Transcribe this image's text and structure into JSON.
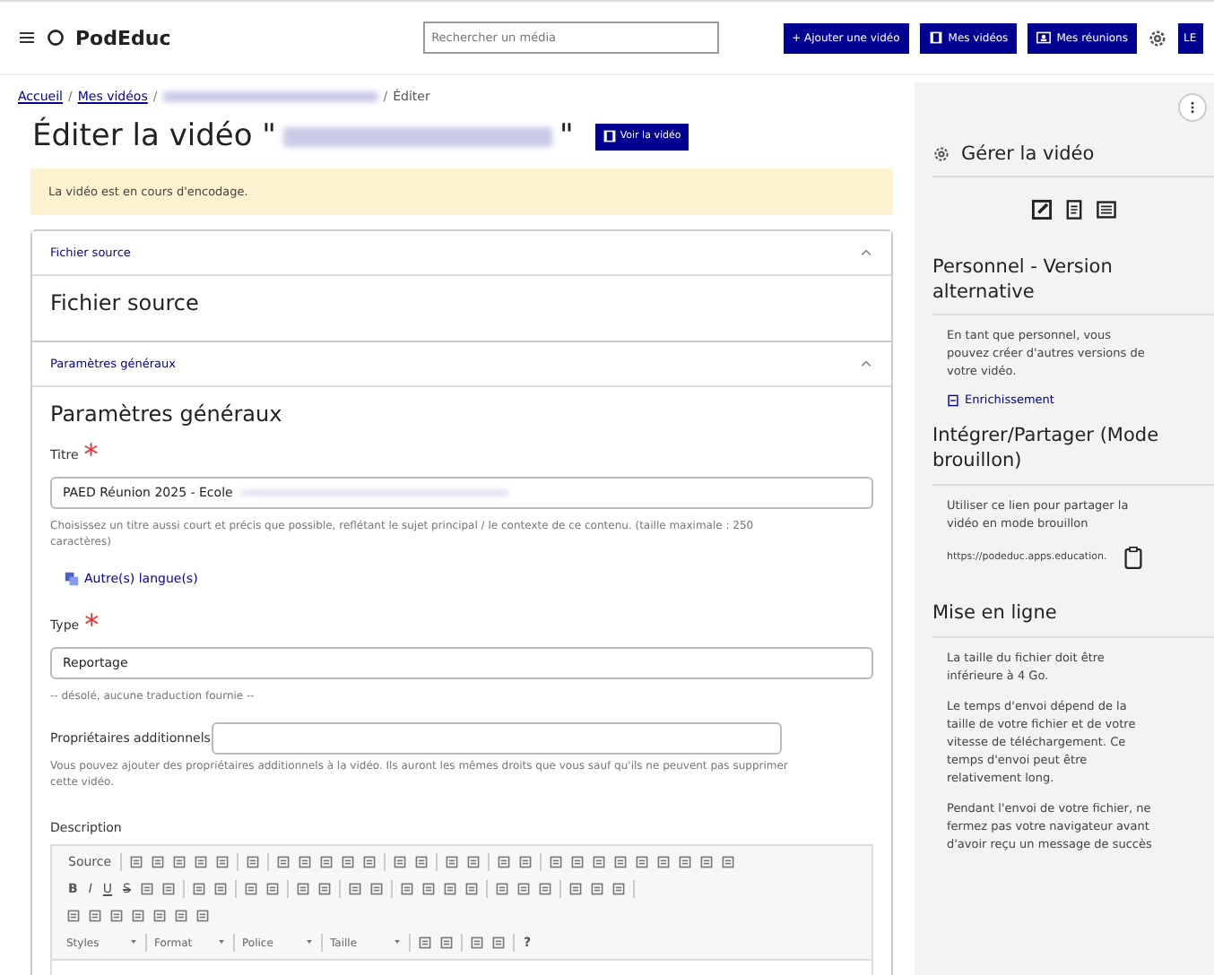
{
  "header": {
    "logo": "PodEduc",
    "search": {
      "placeholder": "Rechercher un média"
    },
    "buttons": [
      {
        "label": "+ Ajouter une vidéo",
        "kind": "text"
      },
      {
        "label": "Mes vidéos",
        "kind": "film"
      },
      {
        "label": "Mes réunions",
        "kind": "meeting"
      }
    ],
    "user": "LE"
  },
  "breadcrumb": [
    {
      "kind": "link",
      "label": "Accueil"
    },
    {
      "kind": "link",
      "label": "Mes vidéos",
      "separator": "/"
    },
    {
      "kind": "blurred",
      "separator": "/"
    },
    {
      "kind": "current",
      "label": "Éditer",
      "separator": "/"
    }
  ],
  "page_title": {
    "before": "Éditer la vidéo \"",
    "after": "\"",
    "button": "Voir la vidéo"
  },
  "alert": "La vidéo est en cours d'encodage.",
  "accordions": [
    {
      "header": "Fichier source",
      "expanded": true,
      "heading": "Fichier source"
    },
    {
      "header": "Paramètres généraux",
      "expanded": true,
      "heading": "Paramètres généraux"
    }
  ],
  "form": {
    "title_field": {
      "label": "Titre",
      "required_mark": "*",
      "value": "PAED Réunion 2025 - Ecole",
      "help": "Choisissez un titre aussi court et précis que possible, reflétant le sujet principal / le contexte de ce contenu. (taille maximale : 250 caractères)"
    },
    "languages_link": "Autre(s) langue(s)",
    "type_field": {
      "label": "Type",
      "required_mark": "*",
      "value": "Reportage",
      "note": "-- désolé, aucune traduction fournie --"
    },
    "owners_field": {
      "label": "Propriétaires additionnels",
      "help": "Vous pouvez ajouter des propriétaires additionnels à la vidéo. Ils auront les mêmes droits que vous sauf qu'ils ne peuvent pas supprimer cette vidéo."
    },
    "description": {
      "label": "Description",
      "toolbar": [
        [
          {
            "kind": "text",
            "label": "Source"
          },
          {
            "kind": "sep"
          },
          {
            "kind": "icon"
          },
          {
            "kind": "icon"
          },
          {
            "kind": "icon"
          },
          {
            "kind": "icon"
          },
          {
            "kind": "icon"
          },
          {
            "kind": "sep"
          },
          {
            "kind": "icon"
          },
          {
            "kind": "sep"
          },
          {
            "kind": "icon"
          },
          {
            "kind": "icon"
          },
          {
            "kind": "icon"
          },
          {
            "kind": "icon"
          },
          {
            "kind": "icon"
          },
          {
            "kind": "sep"
          },
          {
            "kind": "icon"
          },
          {
            "kind": "icon"
          },
          {
            "kind": "sep"
          },
          {
            "kind": "icon"
          },
          {
            "kind": "icon"
          },
          {
            "kind": "sep"
          },
          {
            "kind": "icon"
          },
          {
            "kind": "icon"
          },
          {
            "kind": "sep"
          },
          {
            "kind": "icon"
          },
          {
            "kind": "icon"
          },
          {
            "kind": "icon"
          },
          {
            "kind": "icon"
          },
          {
            "kind": "icon"
          },
          {
            "kind": "icon"
          },
          {
            "kind": "icon"
          },
          {
            "kind": "icon"
          },
          {
            "kind": "icon"
          }
        ],
        [
          {
            "kind": "bold",
            "label": "B"
          },
          {
            "kind": "italic",
            "label": "I"
          },
          {
            "kind": "underline",
            "label": "U"
          },
          {
            "kind": "strike",
            "label": "S"
          },
          {
            "kind": "icon"
          },
          {
            "kind": "icon"
          },
          {
            "kind": "sep"
          },
          {
            "kind": "icon"
          },
          {
            "kind": "icon"
          },
          {
            "kind": "sep"
          },
          {
            "kind": "icon"
          },
          {
            "kind": "icon"
          },
          {
            "kind": "sep"
          },
          {
            "kind": "icon"
          },
          {
            "kind": "icon"
          },
          {
            "kind": "sep"
          },
          {
            "kind": "icon"
          },
          {
            "kind": "icon"
          },
          {
            "kind": "sep"
          },
          {
            "kind": "icon"
          },
          {
            "kind": "icon"
          },
          {
            "kind": "icon"
          },
          {
            "kind": "icon"
          },
          {
            "kind": "sep"
          },
          {
            "kind": "icon"
          },
          {
            "kind": "icon"
          },
          {
            "kind": "icon"
          },
          {
            "kind": "sep"
          },
          {
            "kind": "icon"
          },
          {
            "kind": "icon"
          },
          {
            "kind": "icon"
          },
          {
            "kind": "sep"
          }
        ],
        [
          {
            "kind": "icon"
          },
          {
            "kind": "icon"
          },
          {
            "kind": "icon"
          },
          {
            "kind": "icon"
          },
          {
            "kind": "icon"
          },
          {
            "kind": "icon"
          },
          {
            "kind": "icon"
          }
        ],
        [
          {
            "kind": "dropdown",
            "label": "Styles"
          },
          {
            "kind": "sep"
          },
          {
            "kind": "dropdown",
            "label": "Format"
          },
          {
            "kind": "sep"
          },
          {
            "kind": "dropdown",
            "label": "Police"
          },
          {
            "kind": "sep"
          },
          {
            "kind": "dropdown",
            "label": "Taille"
          },
          {
            "kind": "sep"
          },
          {
            "kind": "icon"
          },
          {
            "kind": "icon"
          },
          {
            "kind": "sep"
          },
          {
            "kind": "icon"
          },
          {
            "kind": "icon"
          },
          {
            "kind": "sep"
          },
          {
            "kind": "bold",
            "label": "?"
          }
        ]
      ]
    }
  },
  "sidebar": {
    "title": "Gérer la vidéo",
    "sections": [
      {
        "heading": "Personnel - Version alternative",
        "items": [
          {
            "kind": "paragraph",
            "text": "En tant que personnel, vous pouvez créer d'autres versions de votre vidéo."
          },
          {
            "kind": "link",
            "text": "Enrichissement"
          }
        ]
      },
      {
        "heading": "Intégrer/Partager (Mode brouillon)",
        "items": [
          {
            "kind": "paragraph",
            "text": "Utiliser ce lien pour partager la vidéo en mode brouillon"
          },
          {
            "kind": "url",
            "text": "https://podeduc.apps.education."
          }
        ]
      },
      {
        "heading": "Mise en ligne",
        "items": [
          {
            "kind": "paragraph",
            "text": "La taille du fichier doit être inférieure à 4 Go."
          },
          {
            "kind": "paragraph",
            "text": "Le temps d'envoi dépend de la taille de votre fichier et de votre vitesse de téléchargement. Ce temps d'envoi peut être relativement long."
          },
          {
            "kind": "paragraph",
            "text": "Pendant l'envoi de votre fichier, ne fermez pas votre navigateur avant d'avoir reçu un message de succès"
          }
        ]
      }
    ]
  }
}
